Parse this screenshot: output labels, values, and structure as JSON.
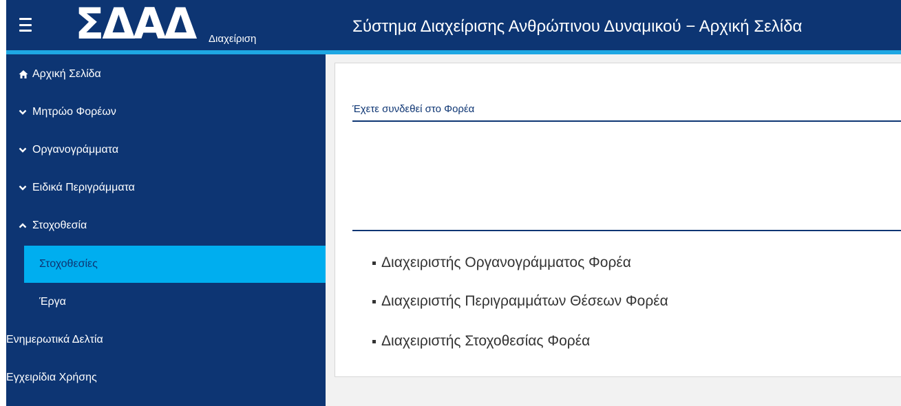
{
  "header": {
    "logo_text": "ΣΔΑΔ",
    "logo_subtitle": "Διαχείριση",
    "title": "Σύστημα Διαχείρισης Ανθρώπινου Δυναμικού − Αρχική Σελίδα",
    "menu_icon": "hamburger-icon"
  },
  "sidebar": {
    "items": [
      {
        "label": "Αρχική Σελίδα",
        "icon": "home-icon"
      },
      {
        "label": "Μητρώο Φορέων",
        "icon": "chevron-down-icon"
      },
      {
        "label": "Οργανογράμματα",
        "icon": "chevron-down-icon"
      },
      {
        "label": "Ειδικά Περιγράμματα",
        "icon": "chevron-down-icon"
      },
      {
        "label": "Στοχοθεσία",
        "icon": "chevron-up-icon"
      },
      {
        "label": "Στοχοθεσίες",
        "active": true
      },
      {
        "label": "Έργα"
      },
      {
        "label": "Ενημερωτικά Δελτία"
      },
      {
        "label": "Εγχειρίδια Χρήσης"
      }
    ]
  },
  "main": {
    "connected_label": "Έχετε συνδεθεί στο Φορέα",
    "roles": [
      "Διαχειριστής Οργανογράμματος Φορέα",
      "Διαχειριστής Περιγραμμάτων Θέσεων Φορέα",
      "Διαχειριστής Στοχοθεσίας Φορέα"
    ]
  },
  "colors": {
    "navy": "#0d3573",
    "accent": "#1ea7e3",
    "active_item": "#00aeef",
    "content_bg": "#f2f2f2"
  }
}
